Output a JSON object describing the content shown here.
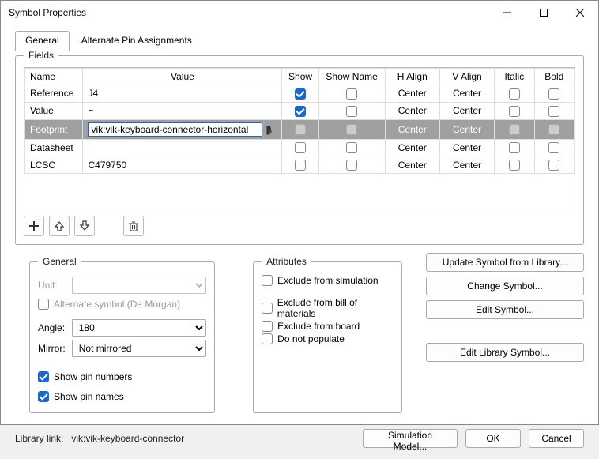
{
  "window": {
    "title": "Symbol Properties"
  },
  "tabs": {
    "general": "General",
    "alternate": "Alternate Pin Assignments",
    "active": "general"
  },
  "fields": {
    "legend": "Fields",
    "headers": {
      "name": "Name",
      "value": "Value",
      "show": "Show",
      "show_name": "Show Name",
      "halign": "H Align",
      "valign": "V Align",
      "italic": "Italic",
      "bold": "Bold"
    },
    "rows": [
      {
        "name": "Reference",
        "value": "J4",
        "show": true,
        "show_name": false,
        "halign": "Center",
        "valign": "Center",
        "italic": false,
        "bold": false,
        "selected": false
      },
      {
        "name": "Value",
        "value": "~",
        "show": true,
        "show_name": false,
        "halign": "Center",
        "valign": "Center",
        "italic": false,
        "bold": false,
        "selected": false
      },
      {
        "name": "Footprint",
        "value": "vik:vik-keyboard-connector-horizontal",
        "show": false,
        "show_name": false,
        "halign": "Center",
        "valign": "Center",
        "italic": false,
        "bold": false,
        "selected": true,
        "editing": true
      },
      {
        "name": "Datasheet",
        "value": "",
        "show": false,
        "show_name": false,
        "halign": "Center",
        "valign": "Center",
        "italic": false,
        "bold": false,
        "selected": false
      },
      {
        "name": "LCSC",
        "value": "C479750",
        "show": false,
        "show_name": false,
        "halign": "Center",
        "valign": "Center",
        "italic": false,
        "bold": false,
        "selected": false
      }
    ]
  },
  "general": {
    "legend": "General",
    "unit_label": "Unit:",
    "unit_value": "",
    "alternate_label": "Alternate symbol (De Morgan)",
    "alternate_checked": false,
    "angle_label": "Angle:",
    "angle_value": "180",
    "mirror_label": "Mirror:",
    "mirror_value": "Not mirrored",
    "show_pin_numbers": {
      "label": "Show pin numbers",
      "checked": true
    },
    "show_pin_names": {
      "label": "Show pin names",
      "checked": true
    }
  },
  "attributes": {
    "legend": "Attributes",
    "exclude_sim": {
      "label": "Exclude from simulation",
      "checked": false
    },
    "exclude_bom": {
      "label": "Exclude from bill of materials",
      "checked": false
    },
    "exclude_board": {
      "label": "Exclude from board",
      "checked": false
    },
    "dnp": {
      "label": "Do not populate",
      "checked": false
    }
  },
  "right_buttons": {
    "update": "Update Symbol from Library...",
    "change": "Change Symbol...",
    "edit": "Edit Symbol...",
    "edit_lib": "Edit Library Symbol..."
  },
  "footer": {
    "library_link_label": "Library link:",
    "library_link_value": "vik:vik-keyboard-connector",
    "sim_model": "Simulation Model...",
    "ok": "OK",
    "cancel": "Cancel"
  }
}
